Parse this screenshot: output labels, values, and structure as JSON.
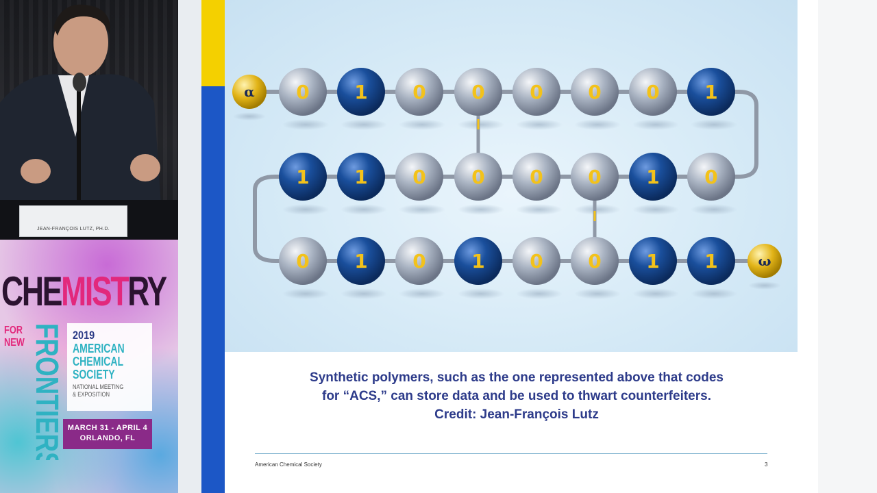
{
  "speaker": {
    "nameplate": "JEAN-FRANÇOIS LUTZ, PH.D."
  },
  "banner": {
    "word_chem_1": "CHE",
    "word_chem_2": "MIST",
    "word_chem_3": "RY",
    "for_new": "FOR\nNEW",
    "frontiers": "FRONTIERS",
    "year": "2019",
    "org": "AMERICAN\nCHEMICAL\nSOCIETY",
    "meeting": "National Meeting\n& Exposition",
    "dates": "MARCH 31 - APRIL 4\nORLANDO, FL"
  },
  "slide": {
    "colors": {
      "bead_dark": "#1a4f9c",
      "bead_light": "#a9b3c2",
      "end_gold": "#e2b418",
      "digit": "#f3c21a"
    },
    "chain": {
      "start_label": "α",
      "end_label": "ω",
      "rows": [
        [
          "0",
          "1",
          "0",
          "0",
          "0",
          "0",
          "0",
          "1"
        ],
        [
          "1",
          "1",
          "0",
          "0",
          "0",
          "0",
          "1",
          "0"
        ],
        [
          "0",
          "1",
          "0",
          "1",
          "0",
          "0",
          "1",
          "1"
        ]
      ]
    },
    "caption": {
      "line1": "Synthetic polymers, such as the one represented above that codes",
      "line2": "for “ACS,” can store data and be used to thwart counterfeiters.",
      "line3": "Credit: Jean-François Lutz"
    },
    "footer_left": "American Chemical Society",
    "footer_right": "3"
  }
}
